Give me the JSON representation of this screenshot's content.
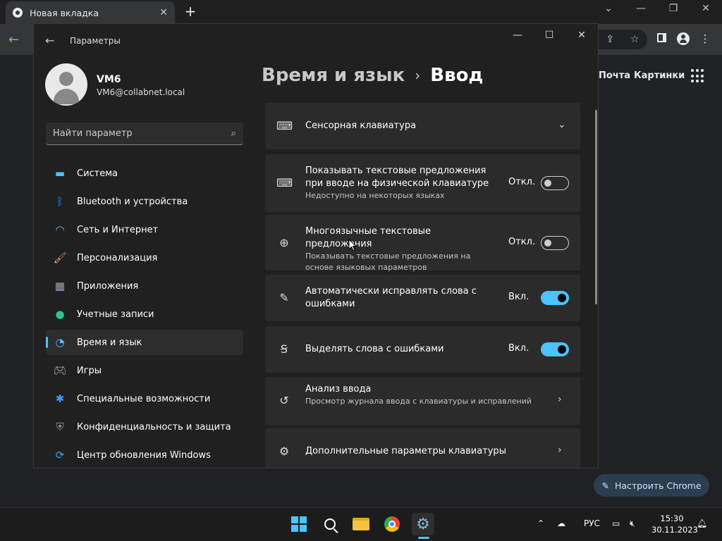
{
  "chrome": {
    "tab_title": "Новая вкладка",
    "close_tab": "✕",
    "new_tab": "+",
    "links": [
      "Почта",
      "Картинки"
    ],
    "customize_label": "Настроить Chrome"
  },
  "settings": {
    "app_title": "Параметры",
    "profile": {
      "name": "VM6",
      "email": "VM6@collabnet.local"
    },
    "search_placeholder": "Найти параметр",
    "nav": [
      {
        "label": "Система",
        "icon": "display-icon",
        "color": "#4cc2ff"
      },
      {
        "label": "Bluetooth и устройства",
        "icon": "bluetooth-icon",
        "color": "#1e90ff"
      },
      {
        "label": "Сеть и Интернет",
        "icon": "wifi-icon",
        "color": "#6fb8ff"
      },
      {
        "label": "Персонализация",
        "icon": "brush-icon",
        "color": "#f0a060"
      },
      {
        "label": "Приложения",
        "icon": "apps-icon",
        "color": "#a0a8b8"
      },
      {
        "label": "Учетные записи",
        "icon": "user-icon",
        "color": "#2ec48e"
      },
      {
        "label": "Время и язык",
        "icon": "globe-clock-icon",
        "color": "#4cc2ff"
      },
      {
        "label": "Игры",
        "icon": "gamepad-icon",
        "color": "#b0b8c8"
      },
      {
        "label": "Специальные возможности",
        "icon": "accessibility-icon",
        "color": "#3aa0ff"
      },
      {
        "label": "Конфиденциальность и защита",
        "icon": "shield-icon",
        "color": "#909090"
      },
      {
        "label": "Центр обновления Windows",
        "icon": "update-icon",
        "color": "#3aa0ff"
      }
    ],
    "active_nav_index": 6,
    "breadcrumb": {
      "parent": "Время и язык",
      "separator": "›",
      "current": "Ввод"
    },
    "cards": [
      {
        "title": "Сенсорная клавиатура",
        "subtitle": "",
        "state": "",
        "toggle": null,
        "chevron": "⌄",
        "icon": "keyboard-icon"
      },
      {
        "title": "Показывать текстовые предложения при вводе на физической клавиатуре",
        "subtitle": "Недоступно на некоторых языках",
        "state": "Откл.",
        "toggle": "off",
        "chevron": "",
        "icon": "keyboard-icon"
      },
      {
        "title": "Многоязычные текстовые предложения",
        "subtitle": "Показывать текстовые предложения на основе языковых параметров",
        "state": "Откл.",
        "toggle": "off",
        "chevron": "",
        "icon": "language-icon"
      },
      {
        "title": "Автоматически исправлять слова с ошибками",
        "subtitle": "",
        "state": "Вкл.",
        "toggle": "on",
        "chevron": "",
        "icon": "autocorrect-icon"
      },
      {
        "title": "Выделять слова с ошибками",
        "subtitle": "",
        "state": "Вкл.",
        "toggle": "on",
        "chevron": "",
        "icon": "spellcheck-icon"
      },
      {
        "title": "Анализ ввода",
        "subtitle": "Просмотр журнала ввода с клавиатуры и исправлений",
        "state": "",
        "toggle": null,
        "chevron": "›",
        "icon": "history-icon"
      },
      {
        "title": "Дополнительные параметры клавиатуры",
        "subtitle": "",
        "state": "",
        "toggle": null,
        "chevron": "›",
        "icon": "gear-icon"
      }
    ]
  },
  "taskbar": {
    "language": "РУС",
    "time": "15:30",
    "date": "30.11.2023"
  }
}
